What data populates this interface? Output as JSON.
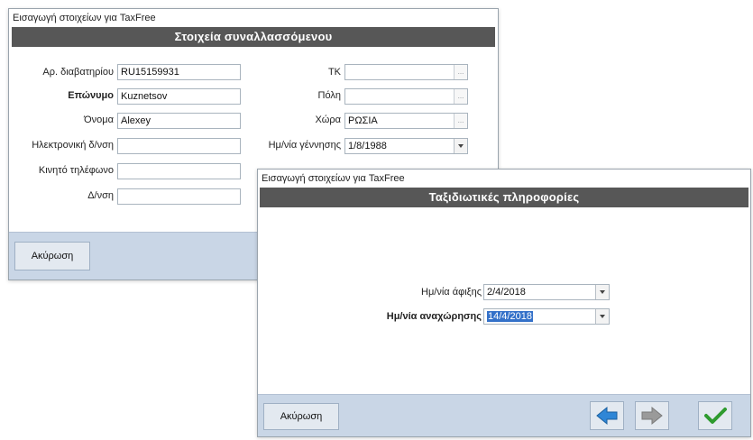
{
  "window1": {
    "title": "Εισαγωγή στοιχείων για TaxFree",
    "header": "Στοιχεία συναλλασσόμενου",
    "fields_left": [
      {
        "label": "Αρ. διαβατηρίου",
        "value": "RU15159931",
        "bold": false
      },
      {
        "label": "Επώνυμο",
        "value": "Kuznetsov",
        "bold": true
      },
      {
        "label": "Όνομα",
        "value": "Alexey",
        "bold": false
      },
      {
        "label": "Ηλεκτρονική δ/νση",
        "value": "",
        "bold": false
      },
      {
        "label": "Κινητό τηλέφωνο",
        "value": "",
        "bold": false
      },
      {
        "label": "Δ/νση",
        "value": "",
        "bold": false
      }
    ],
    "fields_right": [
      {
        "label": "ΤΚ",
        "value": "",
        "ellipsis": "..."
      },
      {
        "label": "Πόλη",
        "value": "",
        "ellipsis": "..."
      },
      {
        "label": "Χώρα",
        "value": "ΡΩΣΙΑ",
        "ellipsis": "..."
      },
      {
        "label": "Ημ/νία γέννησης",
        "value": "1/8/1988"
      }
    ],
    "cancel_label": "Ακύρωση"
  },
  "window2": {
    "title": "Εισαγωγή στοιχείων για TaxFree",
    "header": "Ταξιδιωτικές πληροφορίες",
    "arrival_label": "Ημ/νία άφιξης",
    "arrival_value": "2/4/2018",
    "departure_label": "Ημ/νία αναχώρησης",
    "departure_value": "14/4/2018",
    "cancel_label": "Ακύρωση",
    "icons": {
      "back": "arrow-left-icon",
      "forward": "arrow-right-icon",
      "confirm": "checkmark-icon"
    },
    "colors": {
      "back_arrow": "#2f86d6",
      "forward_arrow": "#9a9a9a",
      "check": "#2e9b2e"
    }
  }
}
